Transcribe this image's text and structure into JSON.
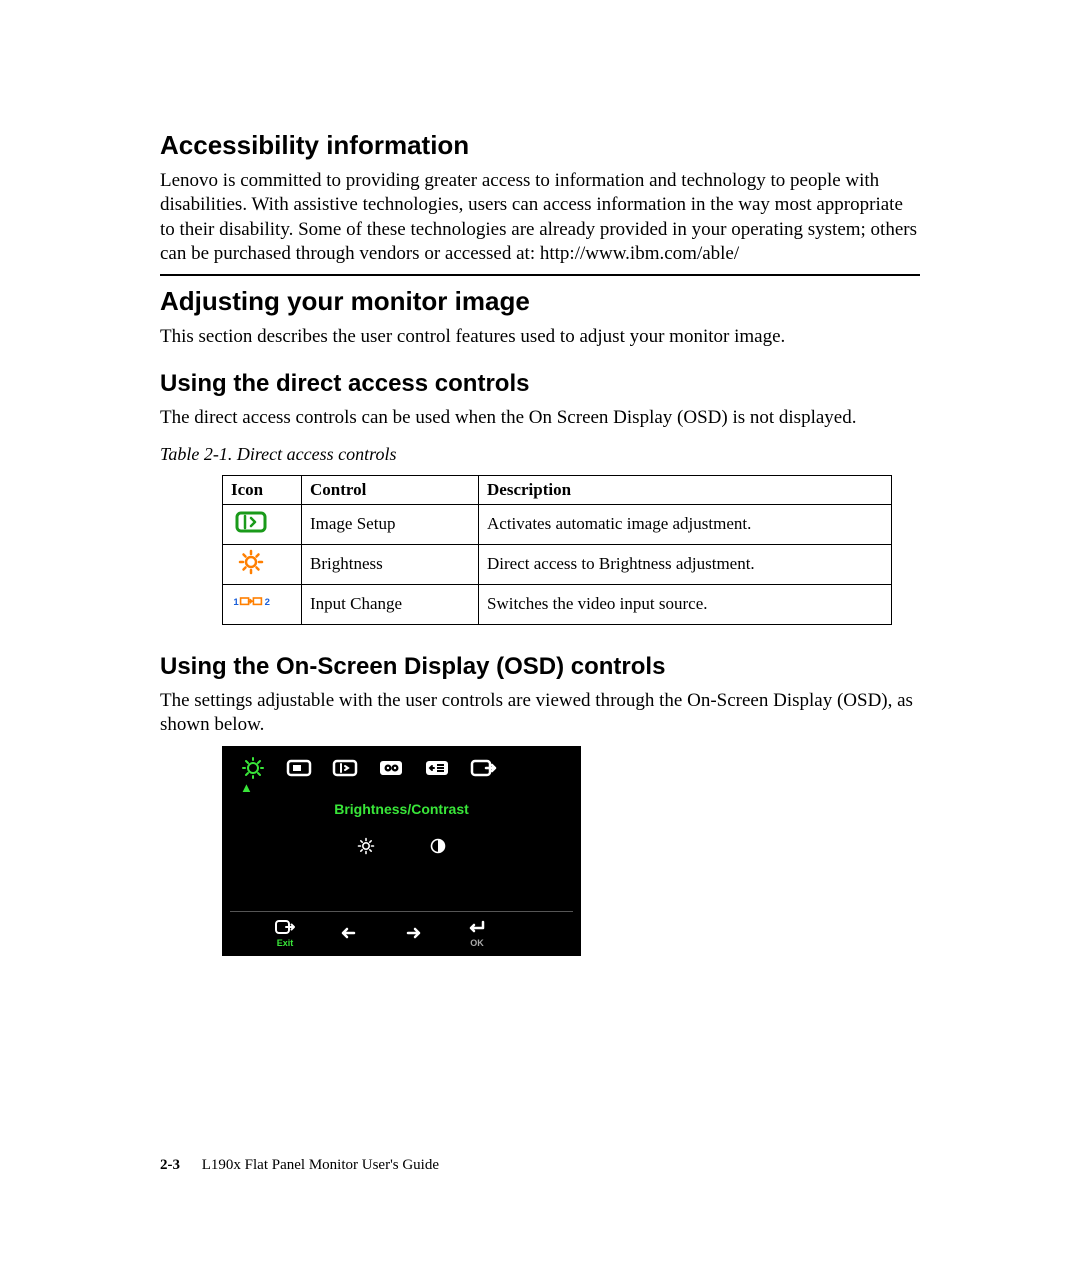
{
  "sections": {
    "accessibility": {
      "heading": "Accessibility information",
      "body": "Lenovo is committed to providing greater access to information and technology to people with disabilities. With assistive technologies, users can access information in the way most appropriate to their disability. Some of these technologies are already provided in your operating system; others can be purchased through vendors or accessed at: http://www.ibm.com/able/"
    },
    "adjusting": {
      "heading": "Adjusting your monitor image",
      "body": "This section describes the user control features used to adjust your monitor image."
    },
    "direct": {
      "heading": "Using the direct access controls",
      "body": "The direct access controls can be used when the On Screen Display (OSD) is not displayed.",
      "caption": "Table 2-1. Direct access controls",
      "table": {
        "headers": [
          "Icon",
          "Control",
          "Description"
        ],
        "rows": [
          {
            "icon": "image-setup-icon",
            "control": "Image Setup",
            "description": "Activates automatic image adjustment."
          },
          {
            "icon": "brightness-icon",
            "control": "Brightness",
            "description": "Direct access to Brightness adjustment."
          },
          {
            "icon": "input-change-icon",
            "control": "Input Change",
            "description": "Switches the video input source."
          }
        ]
      }
    },
    "osd": {
      "heading": "Using the On-Screen Display (OSD) controls",
      "body": "The settings adjustable with the user controls are viewed through the On-Screen Display (OSD), as shown below.",
      "panel": {
        "label": "Brightness/Contrast",
        "exit": "Exit",
        "ok": "OK"
      }
    }
  },
  "footer": {
    "page": "2-3",
    "title": "L190x Flat Panel Monitor User's Guide"
  },
  "colors": {
    "icon_green": "#1a9a1a",
    "icon_orange": "#ff7f00",
    "icon_blue": "#1a5fd9",
    "osd_green": "#39e639"
  }
}
